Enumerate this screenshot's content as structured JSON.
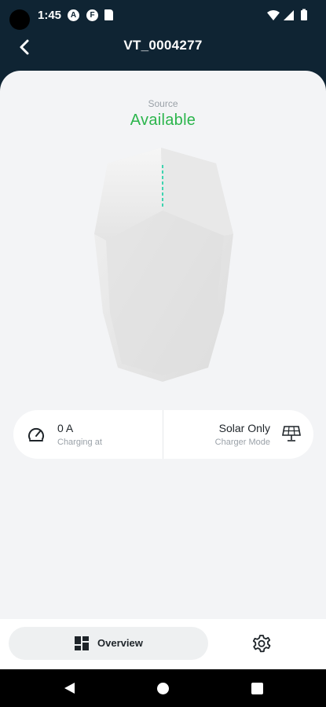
{
  "status_bar": {
    "time": "1:45",
    "notifications": [
      "A",
      "F"
    ]
  },
  "header": {
    "title": "VT_0004277",
    "back_icon": "chevron-left-icon"
  },
  "source": {
    "label": "Source",
    "status": "Available",
    "status_color": "#2bb54c"
  },
  "info": {
    "current_value": "0 A",
    "current_caption": "Charging at",
    "current_icon": "speedometer-icon",
    "mode_value": "Solar Only",
    "mode_caption": "Charger Mode",
    "mode_icon": "solar-panel-icon"
  },
  "bottom_nav": {
    "overview_label": "Overview",
    "overview_icon": "dashboard-icon",
    "settings_icon": "gear-icon"
  },
  "colors": {
    "header_bg": "#0f2433",
    "content_bg": "#f3f4f6",
    "accent_green": "#2bb54c"
  }
}
